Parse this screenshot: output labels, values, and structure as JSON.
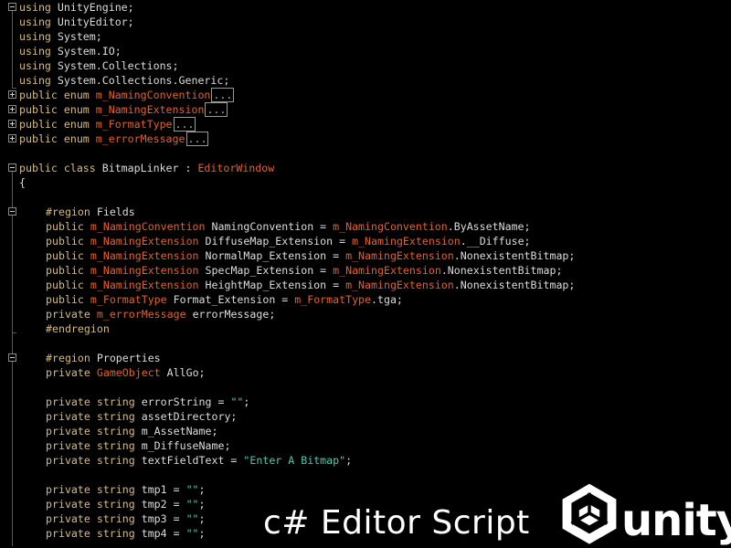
{
  "colors": {
    "background": "#000000",
    "keyword": "#d7ba7d",
    "type": "#e0612e",
    "string": "#4ec9b0",
    "text": "#dcdcdc"
  },
  "lines": [
    {
      "indent": 0,
      "fold": "minus",
      "segs": [
        [
          "kw",
          "using"
        ],
        [
          "pl",
          " UnityEngine;"
        ]
      ]
    },
    {
      "indent": 0,
      "segs": [
        [
          "kw",
          "using"
        ],
        [
          "pl",
          " UnityEditor;"
        ]
      ]
    },
    {
      "indent": 0,
      "segs": [
        [
          "kw",
          "using"
        ],
        [
          "pl",
          " System;"
        ]
      ]
    },
    {
      "indent": 0,
      "segs": [
        [
          "kw",
          "using"
        ],
        [
          "pl",
          " System.IO;"
        ]
      ]
    },
    {
      "indent": 0,
      "segs": [
        [
          "kw",
          "using"
        ],
        [
          "pl",
          " System.Collections;"
        ]
      ]
    },
    {
      "indent": 0,
      "segs": [
        [
          "kw",
          "using"
        ],
        [
          "pl",
          " System.Collections.Generic;"
        ]
      ]
    },
    {
      "indent": 0,
      "fold": "plus",
      "segs": [
        [
          "kw",
          "public enum"
        ],
        [
          "pl",
          " "
        ],
        [
          "ty",
          "m_NamingConvention"
        ],
        [
          "box",
          "..."
        ]
      ]
    },
    {
      "indent": 0,
      "fold": "plus",
      "segs": [
        [
          "kw",
          "public enum"
        ],
        [
          "pl",
          " "
        ],
        [
          "ty",
          "m_NamingExtension"
        ],
        [
          "box",
          "..."
        ]
      ]
    },
    {
      "indent": 0,
      "fold": "plus",
      "segs": [
        [
          "kw",
          "public enum"
        ],
        [
          "pl",
          " "
        ],
        [
          "ty",
          "m_FormatType"
        ],
        [
          "box",
          "..."
        ]
      ]
    },
    {
      "indent": 0,
      "fold": "plus",
      "segs": [
        [
          "kw",
          "public enum"
        ],
        [
          "pl",
          " "
        ],
        [
          "ty",
          "m_errorMessage"
        ],
        [
          "box",
          "..."
        ]
      ]
    },
    {
      "indent": 0,
      "segs": []
    },
    {
      "indent": 0,
      "fold": "minus",
      "segs": [
        [
          "kw",
          "public class"
        ],
        [
          "pl",
          " BitmapLinker : "
        ],
        [
          "ty",
          "EditorWindow"
        ]
      ]
    },
    {
      "indent": 0,
      "segs": [
        [
          "pl",
          "{"
        ]
      ]
    },
    {
      "indent": 0,
      "segs": []
    },
    {
      "indent": 1,
      "fold": "minus",
      "segs": [
        [
          "kw",
          "#region"
        ],
        [
          "pl",
          " Fields"
        ]
      ]
    },
    {
      "indent": 1,
      "segs": [
        [
          "kw",
          "public"
        ],
        [
          "pl",
          " "
        ],
        [
          "ty",
          "m_NamingConvention"
        ],
        [
          "pl",
          " NamingConvention = "
        ],
        [
          "ty",
          "m_NamingConvention"
        ],
        [
          "pl",
          ".ByAssetName;"
        ]
      ]
    },
    {
      "indent": 1,
      "segs": [
        [
          "kw",
          "public"
        ],
        [
          "pl",
          " "
        ],
        [
          "ty",
          "m_NamingExtension"
        ],
        [
          "pl",
          " DiffuseMap_Extension = "
        ],
        [
          "ty",
          "m_NamingExtension"
        ],
        [
          "pl",
          ".__Diffuse;"
        ]
      ]
    },
    {
      "indent": 1,
      "segs": [
        [
          "kw",
          "public"
        ],
        [
          "pl",
          " "
        ],
        [
          "ty",
          "m_NamingExtension"
        ],
        [
          "pl",
          " NormalMap_Extension = "
        ],
        [
          "ty",
          "m_NamingExtension"
        ],
        [
          "pl",
          ".NonexistentBitmap;"
        ]
      ]
    },
    {
      "indent": 1,
      "segs": [
        [
          "kw",
          "public"
        ],
        [
          "pl",
          " "
        ],
        [
          "ty",
          "m_NamingExtension"
        ],
        [
          "pl",
          " SpecMap_Extension = "
        ],
        [
          "ty",
          "m_NamingExtension"
        ],
        [
          "pl",
          ".NonexistentBitmap;"
        ]
      ]
    },
    {
      "indent": 1,
      "segs": [
        [
          "kw",
          "public"
        ],
        [
          "pl",
          " "
        ],
        [
          "ty",
          "m_NamingExtension"
        ],
        [
          "pl",
          " HeightMap_Extension = "
        ],
        [
          "ty",
          "m_NamingExtension"
        ],
        [
          "pl",
          ".NonexistentBitmap;"
        ]
      ]
    },
    {
      "indent": 1,
      "segs": [
        [
          "kw",
          "public"
        ],
        [
          "pl",
          " "
        ],
        [
          "ty",
          "m_FormatType"
        ],
        [
          "pl",
          " Format_Extension = "
        ],
        [
          "ty",
          "m_FormatType"
        ],
        [
          "pl",
          ".tga;"
        ]
      ]
    },
    {
      "indent": 1,
      "segs": [
        [
          "kw",
          "private"
        ],
        [
          "pl",
          " "
        ],
        [
          "ty",
          "m_errorMessage"
        ],
        [
          "pl",
          " errorMessage;"
        ]
      ]
    },
    {
      "indent": 1,
      "segs": [
        [
          "kw",
          "#endregion"
        ]
      ]
    },
    {
      "indent": 1,
      "segs": []
    },
    {
      "indent": 1,
      "fold": "minus",
      "segs": [
        [
          "kw",
          "#region"
        ],
        [
          "pl",
          " Properties"
        ]
      ]
    },
    {
      "indent": 1,
      "segs": [
        [
          "kw",
          "private"
        ],
        [
          "pl",
          " "
        ],
        [
          "ty",
          "GameObject"
        ],
        [
          "pl",
          " AllGo;"
        ]
      ]
    },
    {
      "indent": 1,
      "segs": []
    },
    {
      "indent": 1,
      "segs": [
        [
          "kw",
          "private string"
        ],
        [
          "pl",
          " errorString = "
        ],
        [
          "st",
          "\"\""
        ],
        [
          "pl",
          ";"
        ]
      ]
    },
    {
      "indent": 1,
      "segs": [
        [
          "kw",
          "private string"
        ],
        [
          "pl",
          " assetDirectory;"
        ]
      ]
    },
    {
      "indent": 1,
      "segs": [
        [
          "kw",
          "private string"
        ],
        [
          "pl",
          " m_AssetName;"
        ]
      ]
    },
    {
      "indent": 1,
      "segs": [
        [
          "kw",
          "private string"
        ],
        [
          "pl",
          " m_DiffuseName;"
        ]
      ]
    },
    {
      "indent": 1,
      "segs": [
        [
          "kw",
          "private string"
        ],
        [
          "pl",
          " textFieldText = "
        ],
        [
          "st",
          "\"Enter A Bitmap\""
        ],
        [
          "pl",
          ";"
        ]
      ]
    },
    {
      "indent": 1,
      "segs": []
    },
    {
      "indent": 1,
      "segs": [
        [
          "kw",
          "private string"
        ],
        [
          "pl",
          " tmp1 = "
        ],
        [
          "st",
          "\"\""
        ],
        [
          "pl",
          ";"
        ]
      ]
    },
    {
      "indent": 1,
      "segs": [
        [
          "kw",
          "private string"
        ],
        [
          "pl",
          " tmp2 = "
        ],
        [
          "st",
          "\"\""
        ],
        [
          "pl",
          ";"
        ]
      ]
    },
    {
      "indent": 1,
      "segs": [
        [
          "kw",
          "private string"
        ],
        [
          "pl",
          " tmp3 = "
        ],
        [
          "st",
          "\"\""
        ],
        [
          "pl",
          ";"
        ]
      ]
    },
    {
      "indent": 1,
      "segs": [
        [
          "kw",
          "private string"
        ],
        [
          "pl",
          " tmp4 = "
        ],
        [
          "st",
          "\"\""
        ],
        [
          "pl",
          ";"
        ]
      ]
    }
  ],
  "caption": "c# Editor Script",
  "logo": {
    "icon": "unity-cube-icon",
    "word": "unity"
  }
}
